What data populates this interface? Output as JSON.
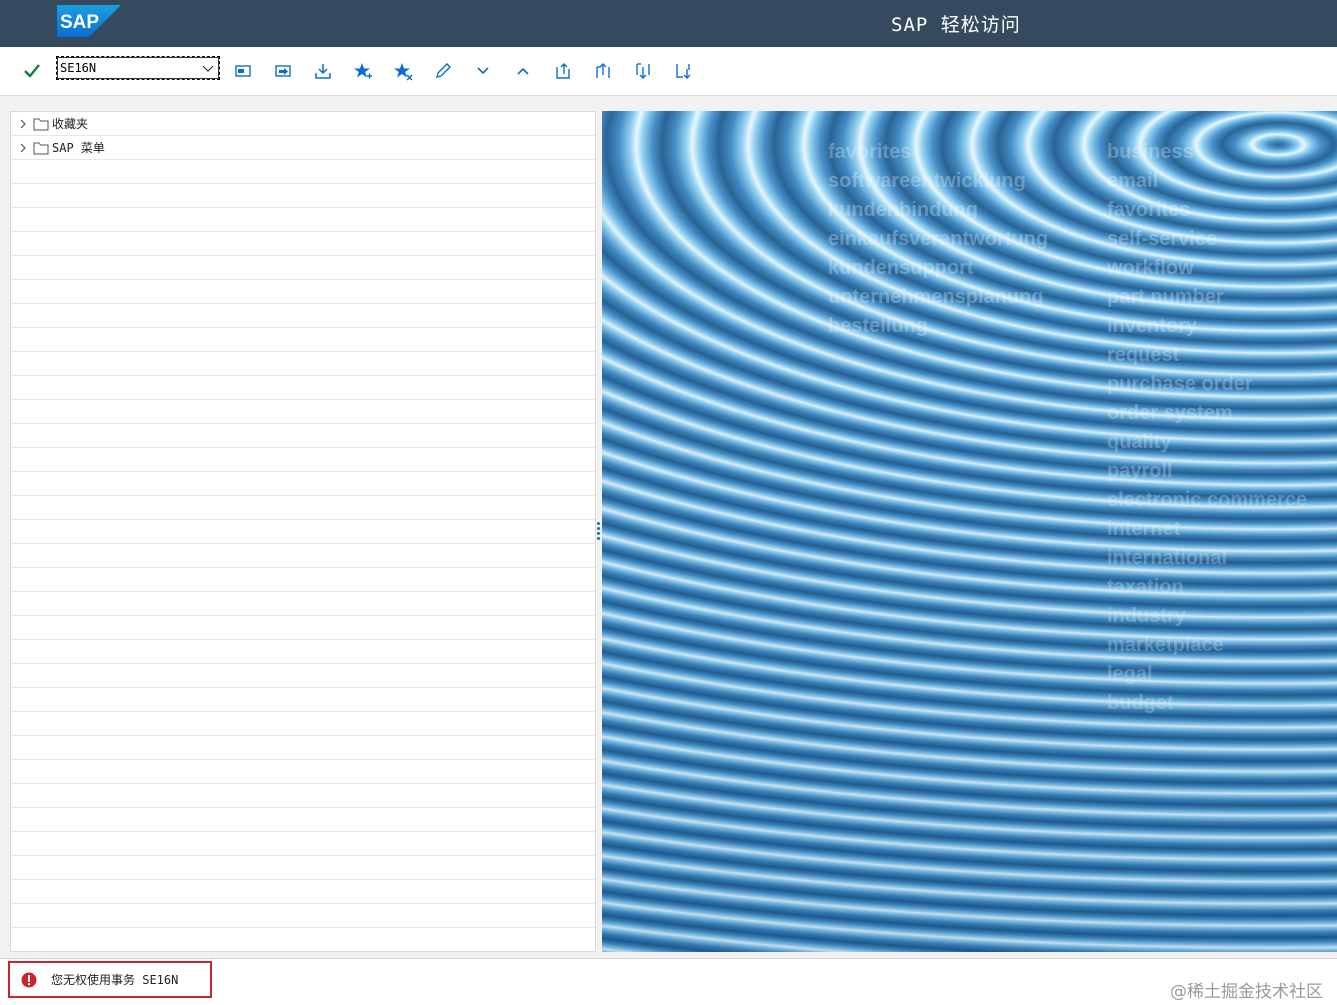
{
  "header": {
    "logo_text": "SAP",
    "title": "SAP 轻松访问"
  },
  "toolbar": {
    "command_field": {
      "value": "SE16N"
    },
    "buttons": [
      "check-icon",
      "sap-menu-icon",
      "user-menu-icon",
      "save-icon",
      "add-favorite-icon",
      "delete-favorite-icon",
      "edit-icon",
      "expand-icon",
      "collapse-icon",
      "move-up-icon",
      "move-top-icon",
      "move-down-icon",
      "move-bottom-icon"
    ]
  },
  "tree": {
    "items": [
      {
        "label": "收藏夹",
        "icon": "folder-icon"
      },
      {
        "label": "SAP 菜单",
        "icon": "folder-icon"
      }
    ]
  },
  "image_panel": {
    "left_words": [
      "favorites",
      "softwareentwicklung",
      "kundenbindung",
      "einkaufsverantwortung",
      "kundensupport",
      "unternehmensplanung",
      "bestellung"
    ],
    "right_words": [
      "business",
      "email",
      "favorites",
      "self-service",
      "workflow",
      "part number",
      "inventory",
      "request",
      "purchase order",
      "order system",
      "quality",
      "payroll",
      "electronic commerce",
      "internet",
      "international",
      "taxation",
      "industry",
      "marketplace",
      "legal",
      "budget"
    ]
  },
  "status": {
    "type": "error",
    "icon": "error-icon",
    "message": "您无权使用事务 SE16N"
  },
  "watermark": "@稀土掘金技术社区",
  "colors": {
    "header_bg": "#354a5f",
    "icon_blue": "#0a6ed1",
    "check_green": "#107e3e",
    "error_red": "#c9252e"
  }
}
